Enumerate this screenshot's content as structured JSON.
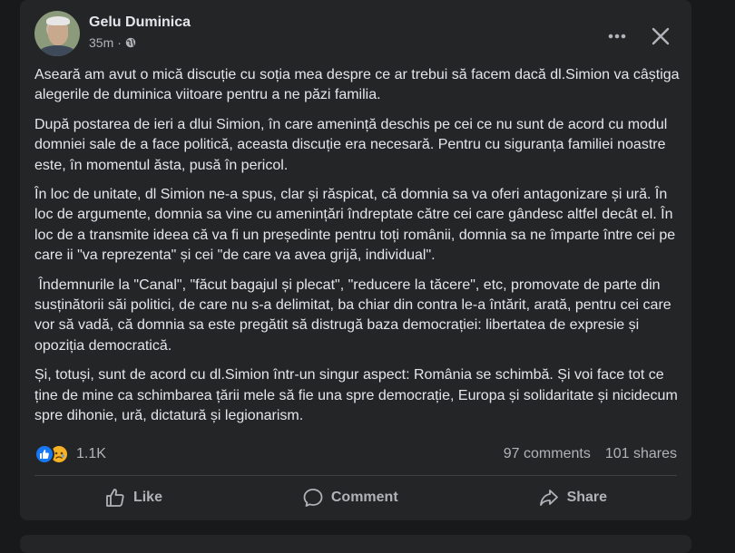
{
  "post": {
    "author": "Gelu Duminica",
    "time": "35m",
    "paragraphs": [
      "Aseară am avut o mică discuție cu soția mea despre ce ar trebui să facem dacă dl.Simion va câștiga alegerile de duminica viitoare pentru a ne păzi familia.",
      "După postarea de ieri a dlui Simion, în care amenință deschis pe cei ce nu sunt de acord cu modul domniei sale de a face politică, aceasta discuție era necesară. Pentru cu siguranța familiei noastre este, în momentul ăsta, pusă în pericol.",
      "În loc de unitate, dl Simion ne-a spus, clar și răspicat, că domnia sa va oferi antagonizare și ură. În loc de argumente, domnia sa vine cu amenințări îndreptate către cei care gândesc altfel decât el. În loc de a transmite ideea că va fi un președinte pentru toți românii, domnia sa ne împarte între cei pe care ii \"va reprezenta\" și cei \"de care va avea grijă, individual\".",
      " Îndemnurile la \"Canal\", \"făcut bagajul și plecat\", \"reducere la tăcere\", etc, promovate de parte din susținătorii săi politici, de care nu s-a delimitat, ba chiar din contra le-a întărit, arată, pentru cei care vor să vadă, că domnia sa este pregătit să distrugă baza democrației: libertatea de expresie și opoziția democratică.",
      "Și, totuși, sunt de acord cu dl.Simion într-un singur aspect: România se schimbă. Și voi face tot ce ține de mine ca schimbarea țării mele să fie una spre democrație, Europa și solidaritate și nicidecum spre dihonie, ură, dictatură și legionarism."
    ],
    "reactions_count": "1.1K",
    "comments": "97 comments",
    "shares": "101 shares"
  },
  "actions": {
    "like": "Like",
    "comment": "Comment",
    "share": "Share"
  },
  "icons": {
    "privacy": "globe-icon",
    "more": "more-options-icon",
    "close": "close-icon",
    "reaction_1": "like-reaction-icon",
    "reaction_2": "sad-reaction-icon"
  },
  "colors": {
    "background": "#18191a",
    "card": "#242526",
    "text": "#e4e6eb",
    "secondary_text": "#b0b3b8",
    "like_blue": "#1877f2",
    "sad_yellow": "#f7b125"
  }
}
